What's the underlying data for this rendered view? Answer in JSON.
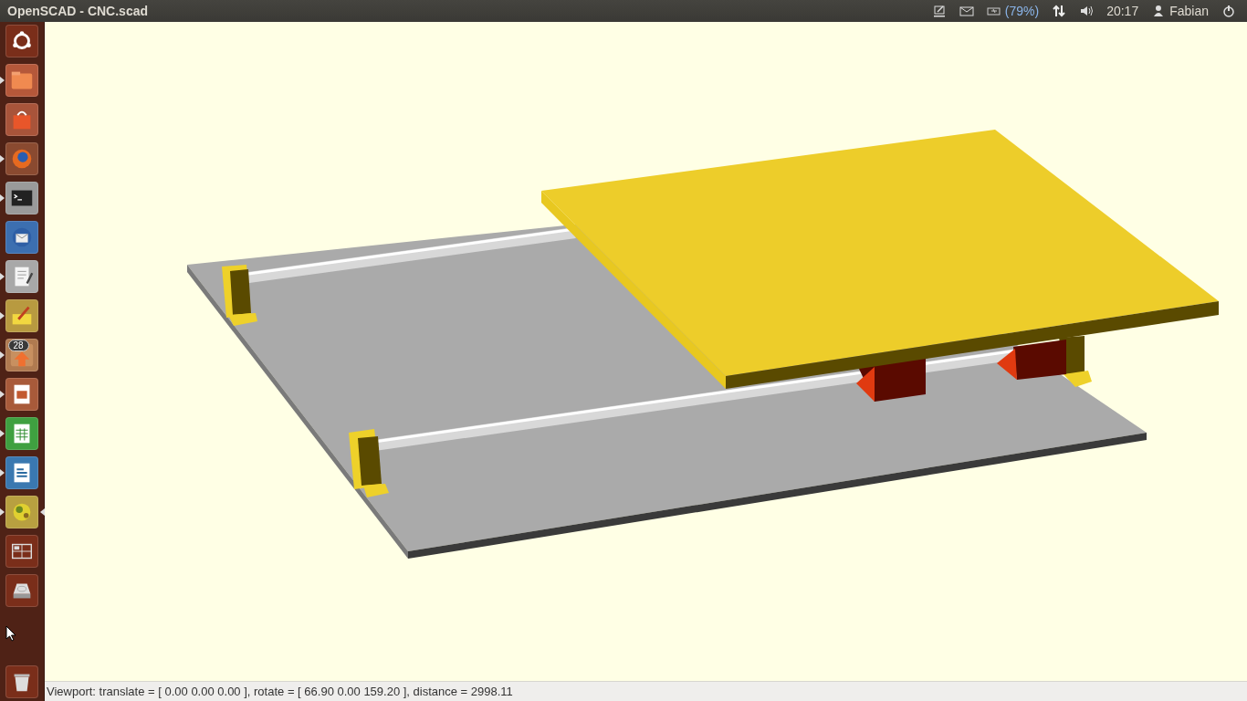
{
  "window": {
    "title": "OpenSCAD - CNC.scad"
  },
  "indicators": {
    "battery": "(79%)",
    "clock": "20:17",
    "user": "Fabian"
  },
  "launcher": [
    {
      "kind": "home",
      "running": false,
      "focused": false
    },
    {
      "kind": "files",
      "running": true,
      "focused": false
    },
    {
      "kind": "software",
      "running": false,
      "focused": false
    },
    {
      "kind": "firefox",
      "running": true,
      "focused": false
    },
    {
      "kind": "terminal",
      "running": true,
      "focused": false
    },
    {
      "kind": "mail",
      "running": false,
      "focused": false
    },
    {
      "kind": "editor",
      "running": true,
      "focused": false
    },
    {
      "kind": "notes",
      "running": true,
      "focused": false
    },
    {
      "kind": "updates",
      "running": true,
      "focused": false,
      "badge": "28"
    },
    {
      "kind": "impress",
      "running": true,
      "focused": false
    },
    {
      "kind": "calc",
      "running": true,
      "focused": false
    },
    {
      "kind": "writer",
      "running": true,
      "focused": false
    },
    {
      "kind": "openscad",
      "running": true,
      "focused": true
    },
    {
      "kind": "workspaces",
      "running": false,
      "focused": false
    },
    {
      "kind": "disk",
      "running": false,
      "focused": false
    },
    {
      "kind": "trash",
      "running": false,
      "focused": false
    }
  ],
  "status_bar": {
    "text": "Viewport: translate = [ 0.00 0.00 0.00 ], rotate = [ 66.90 0.00 159.20 ], distance = 2998.11"
  }
}
